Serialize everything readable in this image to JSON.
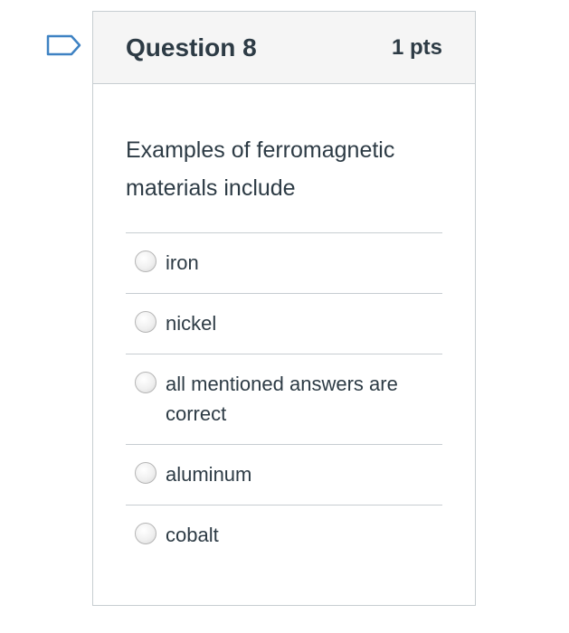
{
  "question": {
    "title": "Question 8",
    "points": "1 pts",
    "text": "Examples of ferromagnetic materials include",
    "answers": [
      {
        "label": "iron",
        "selected": false
      },
      {
        "label": "nickel",
        "selected": false
      },
      {
        "label": "all mentioned answers are correct",
        "selected": false
      },
      {
        "label": "aluminum",
        "selected": false
      },
      {
        "label": "cobalt",
        "selected": false
      }
    ]
  },
  "colors": {
    "text": "#2d3b45",
    "border": "#c7cdd1",
    "header_bg": "#f5f5f5",
    "flag_stroke": "#3e82c3"
  },
  "icons": {
    "flag": "bookmark-flag-icon"
  }
}
